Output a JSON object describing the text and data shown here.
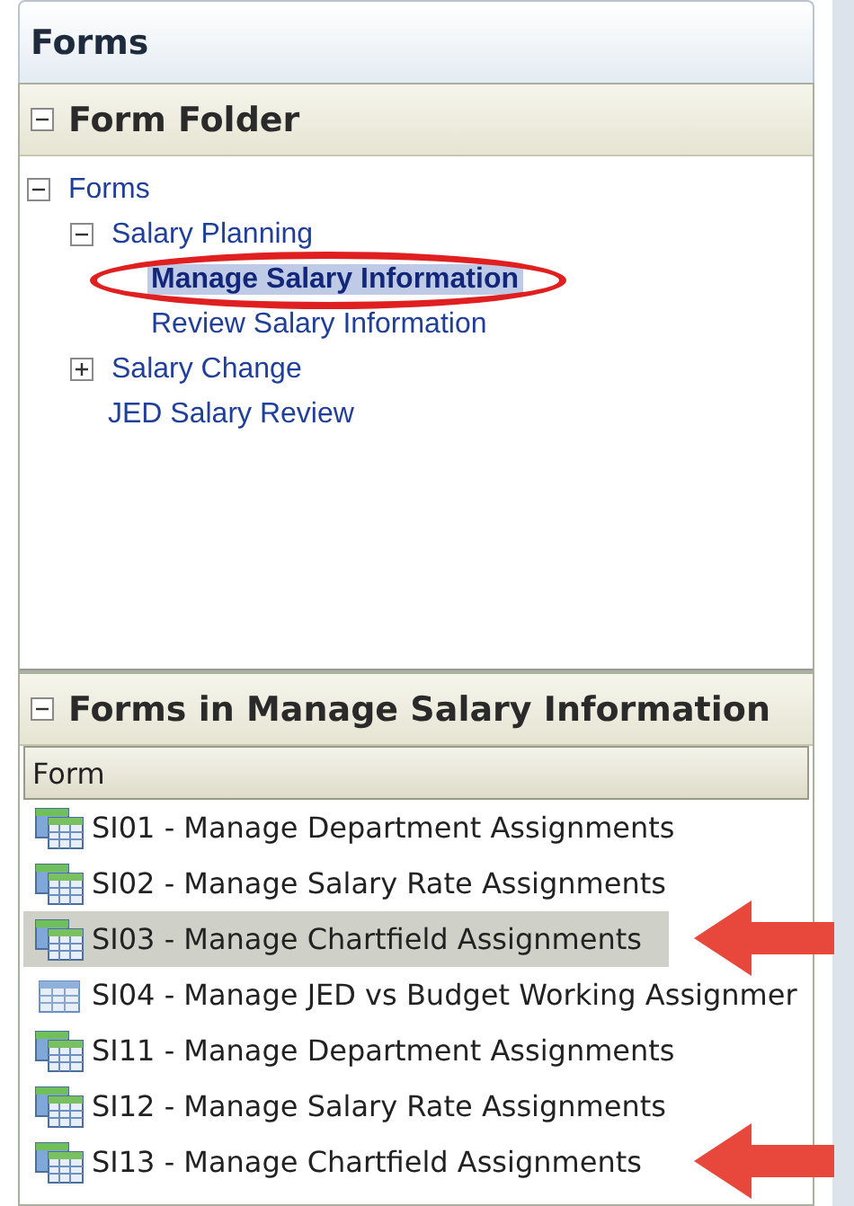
{
  "window": {
    "title": "Forms"
  },
  "form_folder": {
    "title": "Form Folder",
    "expanded": true,
    "tree": [
      {
        "label": "Forms",
        "expanded": true,
        "selected": false,
        "circled": false,
        "children": [
          {
            "label": "Salary Planning",
            "expanded": true,
            "selected": false,
            "circled": false,
            "children": [
              {
                "label": "Manage Salary Information",
                "selected": true,
                "circled": true
              },
              {
                "label": "Review Salary Information",
                "selected": false,
                "circled": false
              }
            ]
          },
          {
            "label": "Salary Change",
            "expanded": false,
            "selected": false,
            "circled": false
          },
          {
            "label": "JED Salary Review",
            "selected": false,
            "circled": false
          }
        ]
      }
    ]
  },
  "forms_list": {
    "title": "Forms in Manage Salary Information",
    "expanded": true,
    "columns": [
      "Form"
    ],
    "rows": [
      {
        "kind": "composite",
        "label": "SI01 - Manage Department Assignments",
        "selected": false,
        "annotated": false
      },
      {
        "kind": "composite",
        "label": "SI02 - Manage Salary Rate Assignments",
        "selected": false,
        "annotated": false
      },
      {
        "kind": "composite",
        "label": "SI03 - Manage Chartfield Assignments",
        "selected": true,
        "annotated": true
      },
      {
        "kind": "simple",
        "label": "SI04 - Manage JED vs Budget Working Assignmer",
        "selected": false,
        "annotated": false
      },
      {
        "kind": "composite",
        "label": "SI11 - Manage Department Assignments",
        "selected": false,
        "annotated": false
      },
      {
        "kind": "composite",
        "label": "SI12 - Manage Salary Rate Assignments",
        "selected": false,
        "annotated": false
      },
      {
        "kind": "composite",
        "label": "SI13 - Manage Chartfield Assignments",
        "selected": false,
        "annotated": true
      }
    ]
  }
}
